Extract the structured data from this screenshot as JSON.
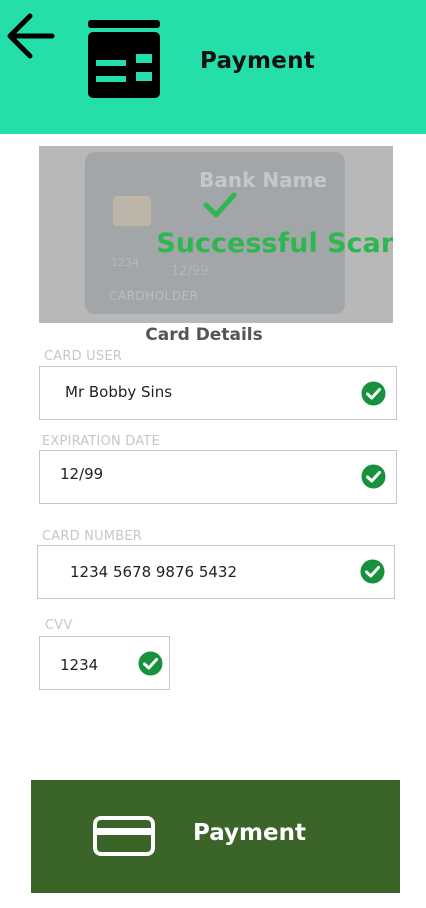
{
  "header": {
    "title": "Payment",
    "back_icon": "arrow-left-icon",
    "logo_icon": "payment-card-reader-icon",
    "background_color": "#25dfaa"
  },
  "scan": {
    "bank_name": "Bank Name",
    "card_number_preview": "1234",
    "expiry_preview": "12/99",
    "cardholder_label": "CARDHOLDER",
    "status": "Successful Scan",
    "status_color": "#2fb74f",
    "check_icon": "checkmark-icon"
  },
  "card_details": {
    "title": "Card Details",
    "fields": [
      {
        "label": "CARD USER",
        "value": "Mr Bobby Sins",
        "status_icon": "check-circle-icon"
      },
      {
        "label": "EXPIRATION DATE",
        "value": "12/99",
        "status_icon": "check-circle-icon"
      },
      {
        "label": "CARD NUMBER",
        "value": "1234 5678 9876 5432",
        "status_icon": "check-circle-icon"
      },
      {
        "label": "CVV",
        "value": "1234",
        "status_icon": "check-circle-icon"
      }
    ]
  },
  "footer": {
    "button_label": "Payment",
    "button_icon": "credit-card-icon",
    "button_color": "#3a6428"
  }
}
